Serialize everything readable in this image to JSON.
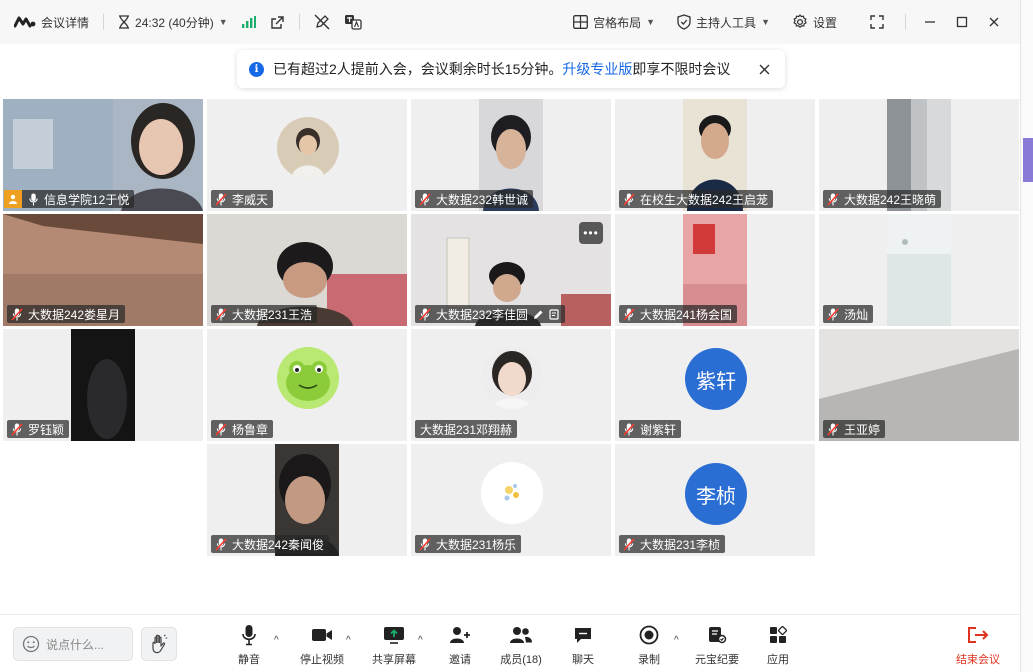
{
  "titlebar": {
    "meeting_info": "会议详情",
    "timer": "24:32 (40分钟)",
    "layout": "宫格布局",
    "host_tools": "主持人工具",
    "settings": "设置"
  },
  "notice": {
    "text_before": "已有超过2人提前入会，会议剩余时长15分钟。",
    "link": "升级专业版",
    "text_after": "即享不限时会议"
  },
  "tiles": [
    {
      "name": "信息学院12于悦",
      "host": true
    },
    {
      "name": "李威天"
    },
    {
      "name": "大数据232韩世诚"
    },
    {
      "name": "在校生大数据242王启茏"
    },
    {
      "name": "大数据242王晓萌"
    },
    {
      "name": "大数据242娄星月"
    },
    {
      "name": "大数据231王浩"
    },
    {
      "name": "大数据232李佳圆"
    },
    {
      "name": "大数据241杨会国"
    },
    {
      "name": "汤灿"
    },
    {
      "name": "罗钰颖"
    },
    {
      "name": "杨鲁章"
    },
    {
      "name": "大数据231邓翔赫"
    },
    {
      "name": "谢紫轩",
      "avatar_text": "紫轩"
    },
    {
      "name": "王亚婷"
    },
    {
      "name": "大数据242秦闻俊"
    },
    {
      "name": "大数据231杨乐"
    },
    {
      "name": "大数据231李桢",
      "avatar_text": "李桢"
    }
  ],
  "toolbar": {
    "chat_placeholder": "说点什么...",
    "mute": "静音",
    "stop_video": "停止视频",
    "share_screen": "共享屏幕",
    "invite": "邀请",
    "members": "成员(18)",
    "chat": "聊天",
    "record": "录制",
    "yuanbao": "元宝纪要",
    "apps": "应用",
    "end": "结束会议"
  },
  "colors": {
    "accent": "#1768e5",
    "end_red": "#e0321f",
    "avatar_blue": "#2a6dd3",
    "signal_green": "#1aad6b"
  }
}
